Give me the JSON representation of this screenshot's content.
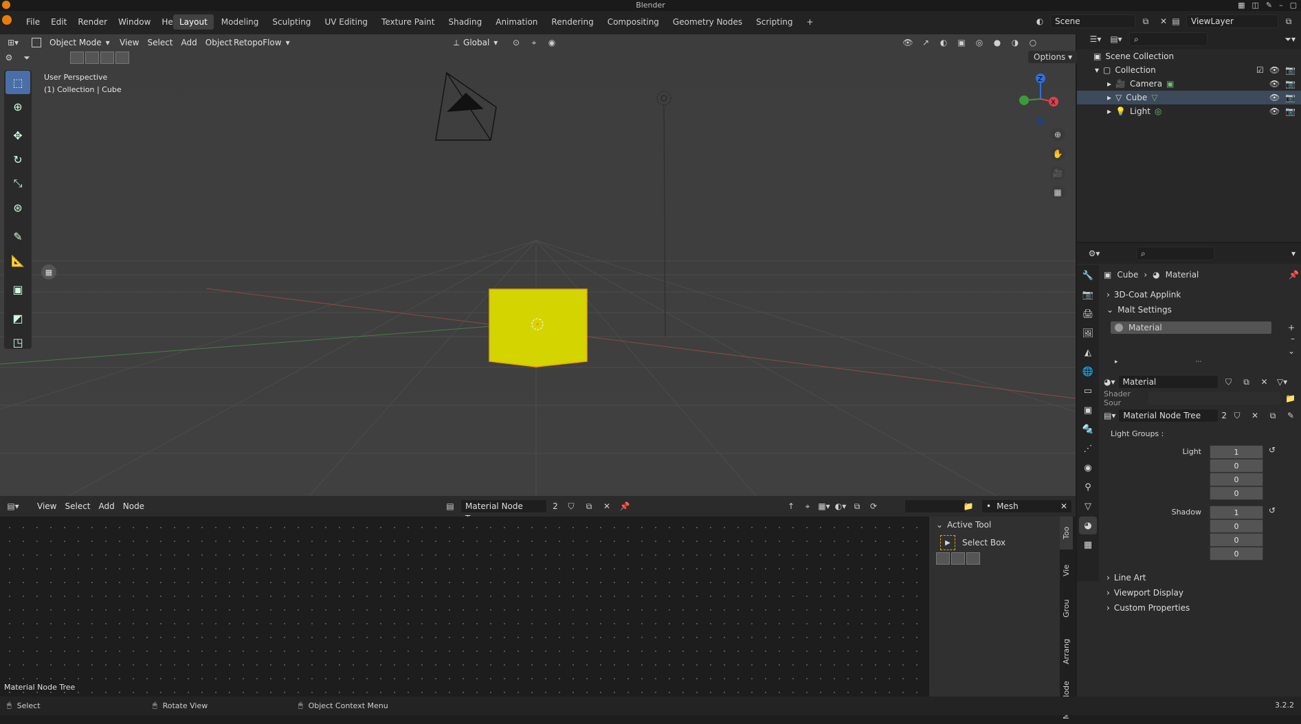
{
  "window": {
    "title": "Blender",
    "version": "3.2.2"
  },
  "menu": [
    "File",
    "Edit",
    "Render",
    "Window",
    "Help"
  ],
  "workspaces": [
    "Layout",
    "Modeling",
    "Sculpting",
    "UV Editing",
    "Texture Paint",
    "Shading",
    "Animation",
    "Rendering",
    "Compositing",
    "Geometry Nodes",
    "Scripting"
  ],
  "active_workspace": "Layout",
  "scene": "Scene",
  "view_layer": "ViewLayer",
  "viewport": {
    "mode": "Object Mode",
    "menus": [
      "View",
      "Select",
      "Add",
      "Object"
    ],
    "addon_menu": "RetopoFlow",
    "transform_orientation": "Global",
    "options_label": "Options",
    "info_line1": "User Perspective",
    "info_line2": "(1) Collection | Cube",
    "gizmo_axes": {
      "z": "Z",
      "x": "X"
    }
  },
  "node_editor": {
    "menus": [
      "View",
      "Select",
      "Add",
      "Node"
    ],
    "tree_name": "Material Node Tree",
    "tree_users": "2",
    "mesh_label": "Mesh",
    "footer_label": "Material Node Tree",
    "sidebar": {
      "panel_title": "Active Tool",
      "tool_name": "Select Box"
    },
    "tabs": [
      "Too",
      "Vie",
      "Grou",
      "Arrang",
      "Malt Node"
    ]
  },
  "status_bar": {
    "select": "Select",
    "rotate": "Rotate View",
    "context": "Object Context Menu"
  },
  "outliner": {
    "root": "Scene Collection",
    "collection": "Collection",
    "items": [
      "Camera",
      "Cube",
      "Light"
    ],
    "selected": "Cube"
  },
  "properties": {
    "breadcrumb_object": "Cube",
    "breadcrumb_data": "Material",
    "panels": {
      "applink": "3D-Coat Applink",
      "malt": "Malt Settings",
      "line_art": "Line Art",
      "viewport_display": "Viewport Display",
      "custom_properties": "Custom Properties"
    },
    "material_slot": "Material",
    "material_name": "Material",
    "shader_source_label": "Shader Sour",
    "node_tree_name": "Material Node Tree",
    "node_tree_users": "2",
    "light_groups_label": "Light Groups :",
    "light_label": "Light",
    "light_values": [
      "1",
      "0",
      "0",
      "0"
    ],
    "shadow_label": "Shadow",
    "shadow_values": [
      "1",
      "0",
      "0",
      "0"
    ]
  },
  "colors": {
    "accent": "#4a6fa8",
    "cube": "#d4d400",
    "selected_row": "#3c4a5c",
    "axis_x": "#e0414f",
    "axis_z": "#2f6fde",
    "axis_y": "#3c9a3c"
  }
}
